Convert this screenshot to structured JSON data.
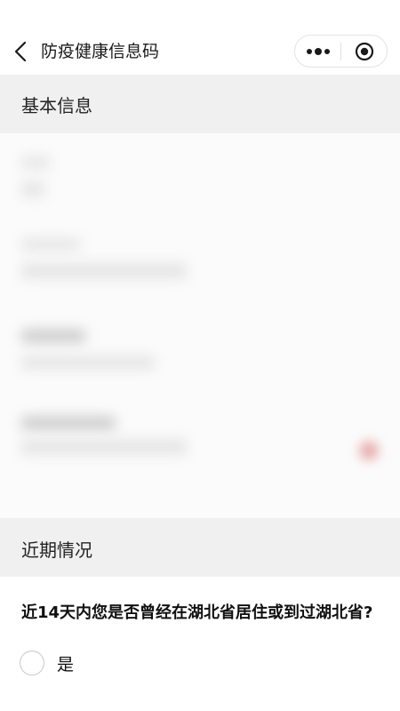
{
  "navbar": {
    "title": "防疫健康信息码",
    "back_icon": "chevron-left-icon",
    "more_icon": "more-dots-icon",
    "close_icon": "target-circle-icon"
  },
  "sections": {
    "basic_info": {
      "title": "基本信息"
    },
    "recent": {
      "title": "近期情况"
    }
  },
  "question": {
    "text": "近14天内您是否曾经在湖北省居住或到过湖北省?",
    "options": [
      {
        "label": "是",
        "selected": false
      }
    ]
  },
  "colors": {
    "section_bg": "#f0f0f0",
    "text": "#1a1a1a",
    "radio_border": "#c8c8c8"
  }
}
